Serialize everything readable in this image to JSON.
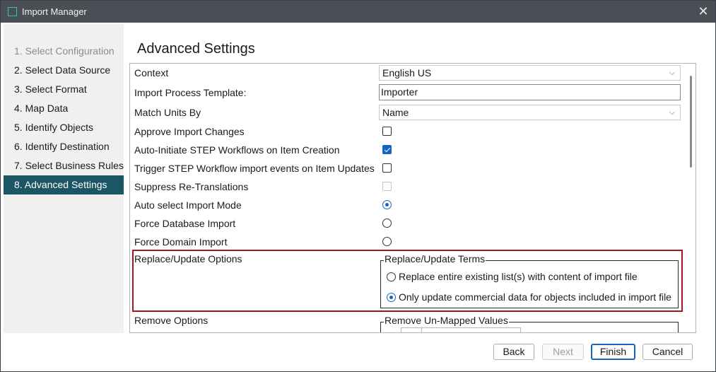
{
  "window": {
    "title": "Import Manager",
    "close_glyph": "✕"
  },
  "steps": [
    {
      "label": "1. Select Configuration",
      "state": "disabled"
    },
    {
      "label": "2. Select Data Source",
      "state": "normal"
    },
    {
      "label": "3. Select Format",
      "state": "normal"
    },
    {
      "label": "4. Map Data",
      "state": "normal"
    },
    {
      "label": "5. Identify Objects",
      "state": "normal"
    },
    {
      "label": "6. Identify Destination",
      "state": "normal"
    },
    {
      "label": "7. Select Business Rules",
      "state": "normal"
    },
    {
      "label": "8. Advanced Settings",
      "state": "active"
    }
  ],
  "page_title": "Advanced Settings",
  "settings": {
    "context": {
      "label": "Context",
      "value": "English US"
    },
    "template": {
      "label": "Import Process Template:",
      "value": "Importer"
    },
    "match_units": {
      "label": "Match Units By",
      "value": "Name"
    },
    "approve": {
      "label": "Approve Import Changes",
      "checked": false
    },
    "auto_initiate": {
      "label": "Auto-Initiate STEP Workflows on Item Creation",
      "checked": true
    },
    "trigger_events": {
      "label": "Trigger STEP Workflow import events on Item Updates",
      "checked": false
    },
    "suppress": {
      "label": "Suppress Re-Translations",
      "checked": false,
      "disabled": true
    },
    "auto_select": {
      "label": "Auto select Import Mode",
      "selected": true
    },
    "force_db": {
      "label": "Force Database Import",
      "selected": false
    },
    "force_domain": {
      "label": "Force Domain Import",
      "selected": false
    },
    "replace_update": {
      "label": "Replace/Update Options",
      "group_title": "Replace/Update Terms",
      "option_replace": "Replace entire existing list(s) with content of import file",
      "option_update": "Only update commercial data for objects included in import file",
      "selected": "update"
    },
    "remove": {
      "label": "Remove Options",
      "group_title": "Remove Un-Mapped Values"
    }
  },
  "buttons": {
    "back": "Back",
    "next": "Next",
    "finish": "Finish",
    "cancel": "Cancel"
  },
  "colors": {
    "active_step": "#1c5563",
    "accent": "#1565c0",
    "highlight": "#a31621",
    "titlebar": "#4a4f55"
  },
  "icons": {
    "dropdown": "chevron-down-icon",
    "app": "app-window-icon",
    "close": "close-icon"
  }
}
